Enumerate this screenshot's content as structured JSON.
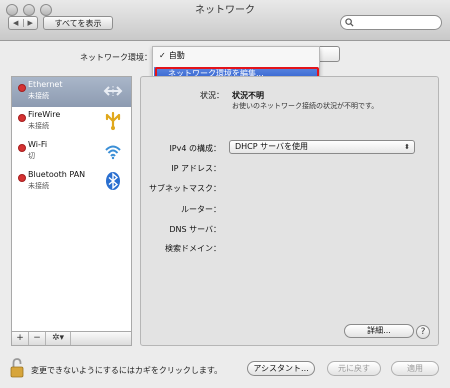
{
  "window": {
    "title": "ネットワーク"
  },
  "toolbar": {
    "back_label": "◀",
    "forward_label": "▶",
    "show_all_label": "すべてを表示",
    "search_placeholder": ""
  },
  "location": {
    "label": "ネットワーク環境：",
    "menu": {
      "selected_item": "自動",
      "check_mark": "✓",
      "edit_item": "ネットワーク環境を編集..."
    }
  },
  "services": [
    {
      "name": "Ethernet",
      "status": "未接続",
      "icon": "ethernet-arrows-icon",
      "selected": true
    },
    {
      "name": "FireWire",
      "status": "未接続",
      "icon": "firewire-icon",
      "selected": false
    },
    {
      "name": "Wi-Fi",
      "status": "切",
      "icon": "wifi-icon",
      "selected": false
    },
    {
      "name": "Bluetooth PAN",
      "status": "未接続",
      "icon": "bluetooth-icon",
      "selected": false
    }
  ],
  "service_controls": {
    "add": "+",
    "remove": "−",
    "action": "✲▾"
  },
  "status": {
    "label": "状況：",
    "value": "状況不明",
    "description": "お使いのネットワーク接続の状況が不明です。"
  },
  "config": {
    "ipv4_label": "IPv4 の構成：",
    "ipv4_value": "DHCP サーバを使用",
    "ip_label": "IP アドレス：",
    "subnet_label": "サブネットマスク：",
    "router_label": "ルーター：",
    "dns_label": "DNS サーバ：",
    "search_domain_label": "検索ドメイン："
  },
  "buttons": {
    "advanced": "詳細...",
    "help": "?",
    "assistant": "アシスタント...",
    "revert": "元に戻す",
    "apply": "適用"
  },
  "footer": {
    "lock_text": "変更できないようにするにはカギをクリックします。"
  },
  "colors": {
    "highlight_box": "#e3141b",
    "menu_selection": "#3b67d6",
    "sidebar_selection": "#9aa8bd"
  }
}
